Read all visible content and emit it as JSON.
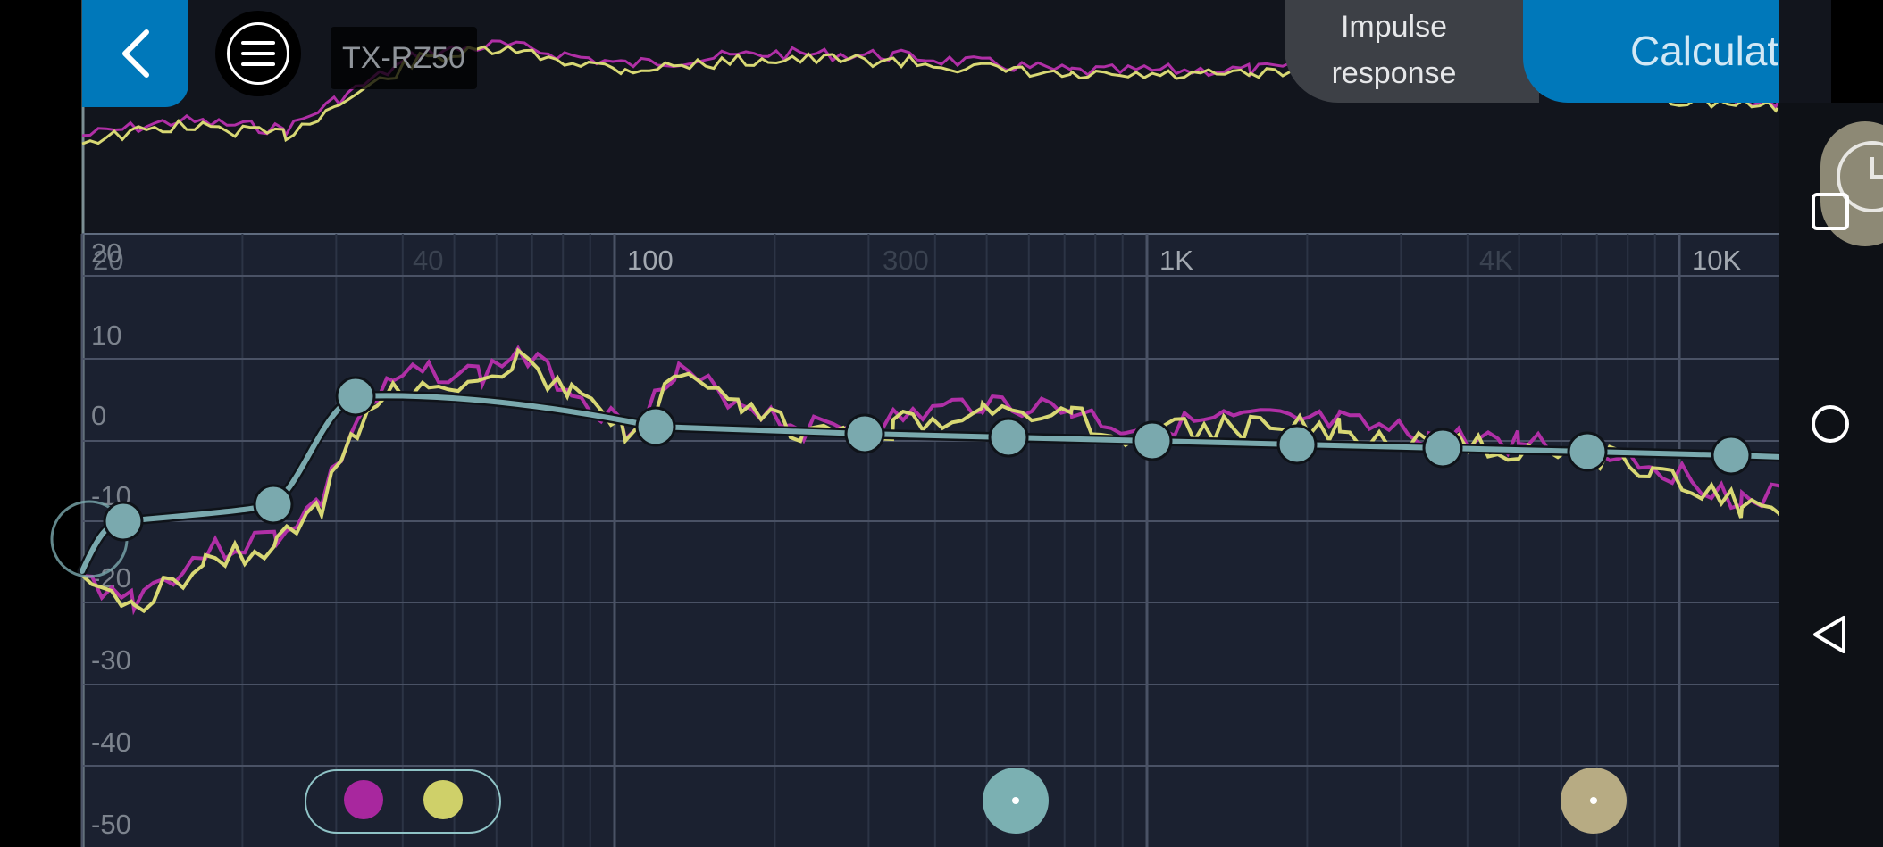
{
  "header": {
    "back_icon": "chevron-left-icon",
    "menu_icon": "hamburger-menu-icon",
    "device_label": "TX-RZ50",
    "impulse_line1": "Impulse",
    "impulse_line2": "response",
    "calculate_label": "Calculate"
  },
  "graph": {
    "x_tick_labels": [
      "20",
      "40",
      "100",
      "300",
      "1K",
      "4K",
      "10K"
    ],
    "y_tick_labels": [
      "20",
      "10",
      "0",
      "-10",
      "-20",
      "-30",
      "-40",
      "-50"
    ],
    "colors": {
      "background": "#1b2130",
      "top_band": "#12151d",
      "grid": "#4a5265",
      "target": "#7aa9ae",
      "series_magenta": "#b02fa6",
      "series_yellow": "#d8d874"
    }
  },
  "nav": {
    "recents_icon": "square-icon",
    "home_icon": "circle-icon",
    "back_icon": "triangle-back-icon",
    "clock_icon": "clock-icon"
  },
  "legend": {
    "magenta_color": "#a8279e",
    "yellow_color": "#cfd069"
  },
  "fabs": {
    "target_color": "#7bb0b2",
    "alt_color": "#b7ab83"
  }
}
